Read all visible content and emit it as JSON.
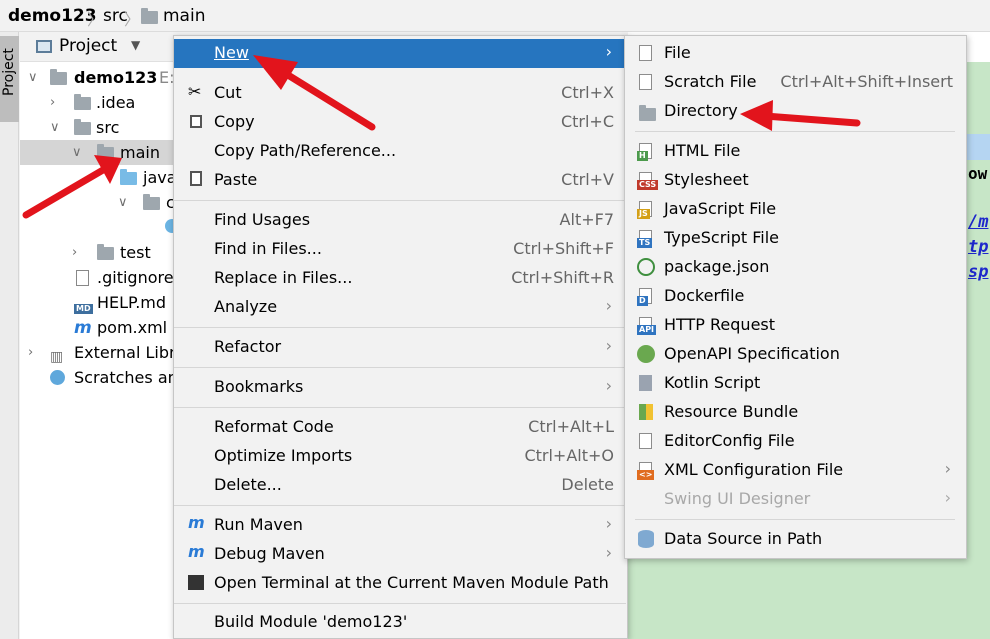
{
  "breadcrumb": [
    "demo123",
    "src",
    "main"
  ],
  "side_tab": "Project",
  "project_header": "Project",
  "tree": {
    "root": "demo123",
    "root_path": "E:",
    "idea": ".idea",
    "src": "src",
    "main": "main",
    "java": "java",
    "c": "c",
    "test": "test",
    "gitignore": ".gitignore",
    "help": "HELP.md",
    "pom": "pom.xml",
    "external": "External Libra",
    "scratches": "Scratches and"
  },
  "editor_fragments": [
    "ow",
    "/m",
    "tp",
    "sp"
  ],
  "context_menu": {
    "new": "New",
    "cut": "Cut",
    "cut_sc": "Ctrl+X",
    "copy": "Copy",
    "copy_sc": "Ctrl+C",
    "copy_path": "Copy Path/Reference...",
    "paste": "Paste",
    "paste_sc": "Ctrl+V",
    "find_usages": "Find Usages",
    "find_usages_sc": "Alt+F7",
    "find_in_files": "Find in Files...",
    "find_in_files_sc": "Ctrl+Shift+F",
    "replace_in_files": "Replace in Files...",
    "replace_in_files_sc": "Ctrl+Shift+R",
    "analyze": "Analyze",
    "refactor": "Refactor",
    "bookmarks": "Bookmarks",
    "reformat": "Reformat Code",
    "reformat_sc": "Ctrl+Alt+L",
    "optimize": "Optimize Imports",
    "optimize_sc": "Ctrl+Alt+O",
    "delete": "Delete...",
    "delete_sc": "Delete",
    "run_maven": "Run Maven",
    "debug_maven": "Debug Maven",
    "open_terminal": "Open Terminal at the Current Maven Module Path",
    "build_module": "Build Module 'demo123'"
  },
  "submenu": {
    "file": "File",
    "scratch": "Scratch File",
    "scratch_sc": "Ctrl+Alt+Shift+Insert",
    "directory": "Directory",
    "html": "HTML File",
    "stylesheet": "Stylesheet",
    "javascript": "JavaScript File",
    "typescript": "TypeScript File",
    "package_json": "package.json",
    "dockerfile": "Dockerfile",
    "http_request": "HTTP Request",
    "openapi": "OpenAPI Specification",
    "kotlin_script": "Kotlin Script",
    "resource_bundle": "Resource Bundle",
    "editorconfig": "EditorConfig File",
    "xml_config": "XML Configuration File",
    "swing": "Swing UI Designer",
    "data_source": "Data Source in Path"
  },
  "icon_badges": {
    "html": "H",
    "css": "CSS",
    "js": "JS",
    "ts": "TS",
    "docker": "D",
    "api": "API",
    "md": "MD"
  },
  "colors": {
    "menu_highlight": "#2675bf",
    "annotation_arrow": "#e2141c",
    "editor_bg": "#c7e6c7"
  }
}
